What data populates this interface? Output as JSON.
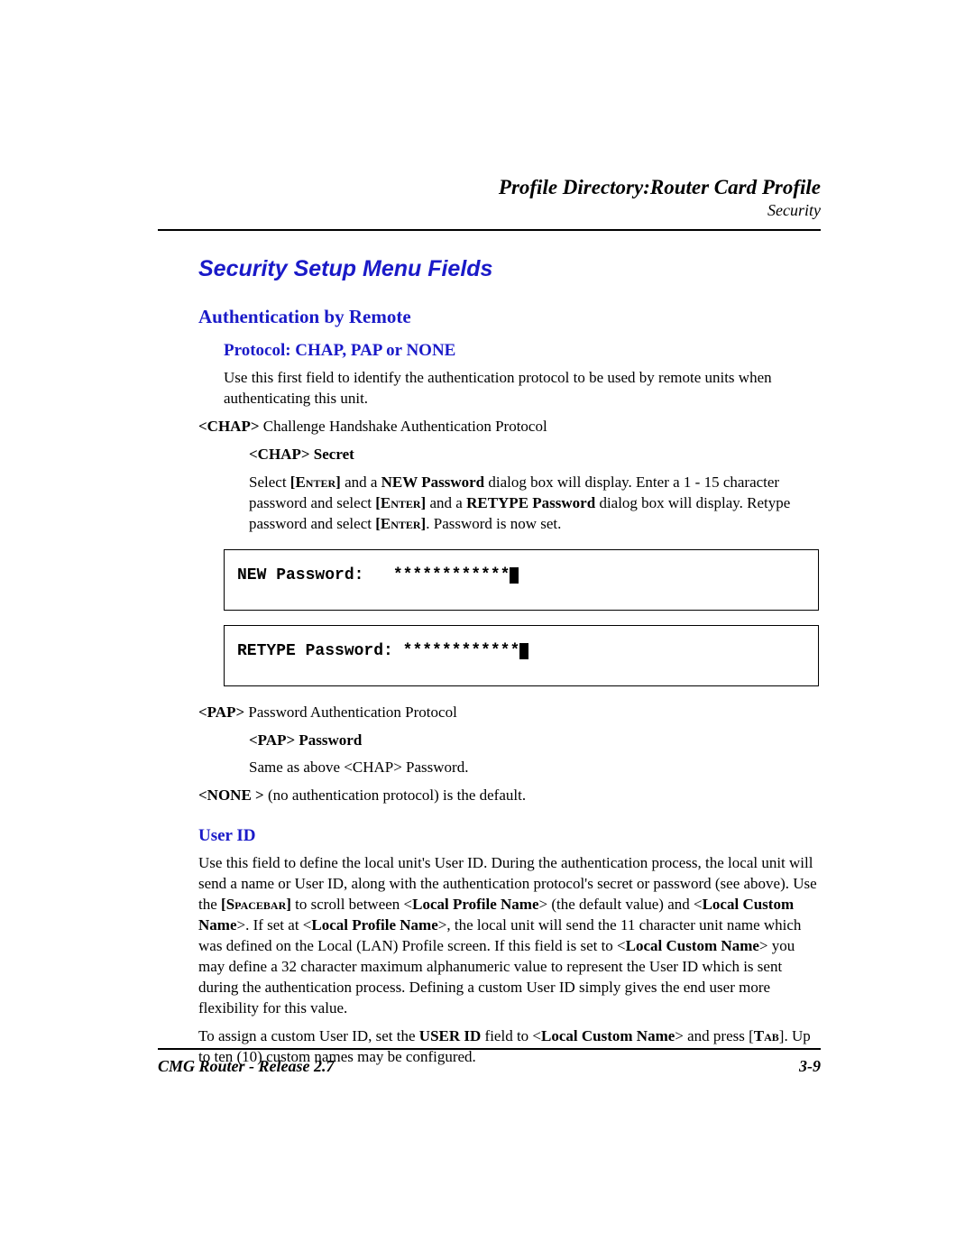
{
  "header": {
    "title": "Profile Directory:Router Card Profile",
    "subtitle": "Security"
  },
  "h1": "Security Setup Menu Fields",
  "auth": {
    "h2": "Authentication by Remote",
    "h3": "Protocol: CHAP, PAP or NONE",
    "intro": "Use this first field to identify the authentication protocol to be used by remote units when authenticating this unit.",
    "chap_tag": "<CHAP>",
    "chap_def": " Challenge Handshake Authentication Protocol",
    "chap_secret_h": "<CHAP> Secret",
    "chap_secret_1a": "Select ",
    "enter1": "[Enter]",
    "chap_secret_1b": " and a ",
    "newpw": "NEW Password",
    "chap_secret_1c": " dialog box will display. Enter a 1 - 15 character password and select ",
    "enter2": "[Enter]",
    "chap_secret_1d": " and a ",
    "retypepw": "RETYPE Password",
    "chap_secret_1e": " dialog box will display.  Retype password and select ",
    "enter3": "[Enter]",
    "chap_secret_1f": ". Password is now set.",
    "term1_label": "NEW Password:   ",
    "term1_mask": "************",
    "term2_label": "RETYPE Password: ",
    "term2_mask": "************",
    "pap_tag": "<PAP>",
    "pap_def": " Password Authentication Protocol",
    "pap_pw_h": "<PAP> Password",
    "pap_pw_body": "Same as above <CHAP> Password.",
    "none_tag": "<NONE >",
    "none_def": " (no authentication protocol) is the default."
  },
  "userid": {
    "h": "User ID",
    "p1a": "Use this field to define the local unit's User ID. During the authentication process, the local unit will send a name or User ID, along with the authentication protocol's secret or password (see above). Use the ",
    "spacebar": "[Spacebar]",
    "p1b": " to scroll between <",
    "lpn": "Local Profile Name",
    "p1c": "> (the default value) and <",
    "lcn": "Local Custom Name",
    "p1d": ">. If set at <",
    "lpn2": "Local Profile Name",
    "p1e": ">, the local unit will send the 11 character unit name which was defined on the Local (LAN) Profile screen. If this field is set to <",
    "lcn2": "Local Custom Name",
    "p1f": "> you may define a 32 character maximum alphanumeric value to represent the User ID which is sent during the authentication process. Defining a custom User ID simply gives the end user more flexibility for this value.",
    "p2a": "To assign a custom User ID, set the ",
    "userid_field": "USER ID",
    "p2b": " field to <",
    "lcn3": "Local Custom Name",
    "p2c": "> and press [",
    "tab": "Tab",
    "p2d": "]. Up to ten (10) custom names may be configured."
  },
  "footer": {
    "left": "CMG Router - Release 2.7",
    "right": "3-9"
  }
}
